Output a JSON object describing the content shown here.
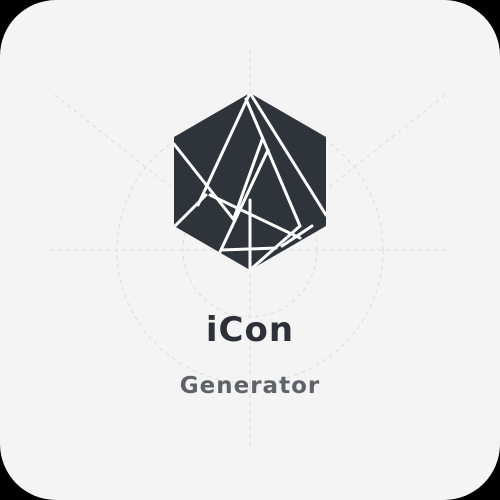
{
  "app_icon": {
    "title": "iCon",
    "subtitle": "Generator",
    "logo_icon": "faceted-hexagon-icon",
    "colors": {
      "background": "#f4f4f4",
      "logo_fill": "#2f343a",
      "logo_lines": "#ffffff",
      "title_text": "#2d3137",
      "subtitle_text": "#5f6368",
      "guide_lines": "#d9d9d9"
    }
  }
}
